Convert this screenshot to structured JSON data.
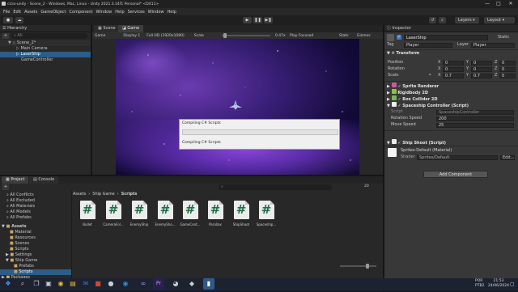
{
  "window": {
    "title": "cicio-unity - Scene_2 - Windows, Mac, Linux - Unity 2021.3.14f1 Personal* <DX11>",
    "minimize": "—",
    "maximize": "□",
    "close": "✕"
  },
  "menu": [
    "File",
    "Edit",
    "Assets",
    "GameObject",
    "Component",
    "Window",
    "Help",
    "Services",
    "Window",
    "Help"
  ],
  "toolbar": {
    "account": "●",
    "cloud": "☁",
    "layers": "Layers",
    "layout": "Layout",
    "play": "▶",
    "pause": "❚❚",
    "step": "▶❚",
    "search": "⌕",
    "history": "↺"
  },
  "hierarchy": {
    "title": "Hierarchy",
    "add": "+",
    "search": "⌕ All",
    "items": [
      {
        "label": "Scene_2*",
        "indent": 0
      },
      {
        "label": "Main Camera",
        "indent": 1
      },
      {
        "label": "LaserShip",
        "indent": 1
      },
      {
        "label": "GameController",
        "indent": 1
      }
    ]
  },
  "scene_tabs": {
    "scene": "Scene",
    "game": "Game"
  },
  "game_bar": {
    "view": "Game",
    "display": "Display 1",
    "resolution": "Full HD (1920x1080)",
    "scale_label": "Scale",
    "scale_value": "0.47x",
    "play_focused": "Play Focused",
    "stats": "Stats",
    "gizmos": "Gizmos"
  },
  "dialog": {
    "title": "Compiling C# Scripts",
    "status": "Compiling C# Scripts",
    "progress": 0.0
  },
  "project": {
    "tab_project": "Project",
    "tab_console": "Console",
    "add": "+",
    "favorites": [
      "All Conflicts",
      "All Excluded",
      "All Materials",
      "All Models",
      "All Prefabs"
    ],
    "assets_root": "Assets",
    "assets": [
      "Material",
      "Resources",
      "Scenes",
      "Scripts",
      "Settings",
      "Ship Game",
      "Prefabs",
      "Scripts"
    ],
    "packages": "Packages",
    "breadcrumb": [
      "Assets",
      "Ship Game",
      "Scripts"
    ],
    "files": [
      "Bullet",
      "CameraFol...",
      "EnemyShip",
      "EnemySho...",
      "GameCont...",
      "Parallax",
      "ShipShoot",
      "Spaceship..."
    ],
    "count": "20"
  },
  "inspector": {
    "title": "Inspector",
    "object_name": "LaserShip",
    "static": "Static",
    "tag_label": "Tag",
    "tag_value": "Player",
    "layer_label": "Layer",
    "layer_value": "Player",
    "transform": {
      "title": "Transform",
      "position": {
        "label": "Position",
        "x": "0",
        "y": "0",
        "z": "0"
      },
      "rotation": {
        "label": "Rotation",
        "x": "0",
        "y": "0",
        "z": "0"
      },
      "scale": {
        "label": "Scale",
        "x": "0.7",
        "y": "0.7",
        "z": "0"
      }
    },
    "components": [
      "Sprite Renderer",
      "Rigidbody 2D",
      "Box Collider 2D",
      "Spaceship Controller (Script)"
    ],
    "script": {
      "label": "Script",
      "value": "SpaceshipController"
    },
    "rotation_speed": {
      "label": "Rotation Speed",
      "value": "200"
    },
    "move_speed": {
      "label": "Move Speed",
      "value": "25"
    },
    "ship_shoot": "Ship Shoot (Script)",
    "material": {
      "name": "Sprites-Default (Material)",
      "shader_label": "Shader",
      "shader_value": "Sprites/Default",
      "edit": "Edit..."
    },
    "add_component": "Add Component"
  },
  "taskbar": {
    "lang": "POR",
    "lang2": "PTB2",
    "time": "21:53",
    "date": "24/06/2024",
    "notifications": "▢"
  },
  "axes": {
    "x": "X",
    "y": "Y",
    "z": "Z"
  },
  "colors": {
    "accent": "#3a79d0",
    "playmode": "#4f7fc9"
  }
}
